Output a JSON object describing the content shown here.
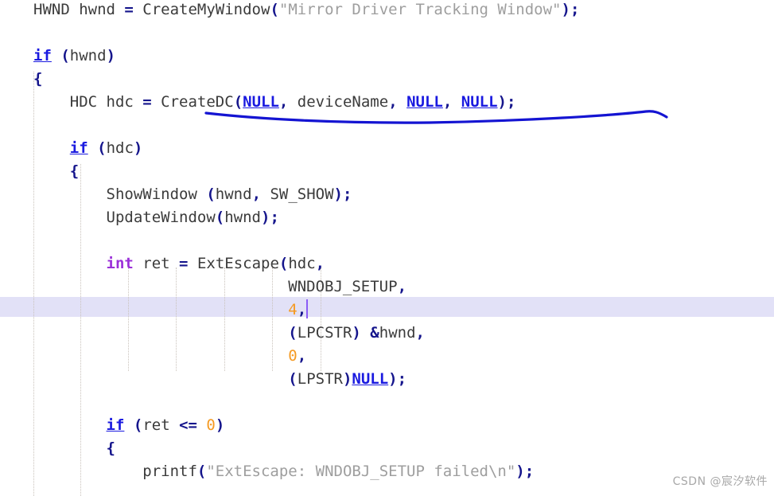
{
  "editor": {
    "language": "C",
    "background_color": "#ffffff",
    "current_line_highlight_color": "#e2e1f7",
    "caret_color": "#8b5cf6",
    "indent_guide_color": "#c9c2bb",
    "colors": {
      "plain_text": "#3b3b3b",
      "keyword": "#1a1ae0",
      "type": "#9b30d9",
      "string": "#9e9e9e",
      "number": "#f59a23",
      "operator": "#15158c",
      "annotation_ink": "#1414d2"
    }
  },
  "lines": [
    {
      "n": 1,
      "text": "HWND hwnd = CreateMyWindow(\"Mirror Driver Tracking Window\");"
    },
    {
      "n": 2,
      "text": ""
    },
    {
      "n": 3,
      "text": "if (hwnd)"
    },
    {
      "n": 4,
      "text": "{"
    },
    {
      "n": 5,
      "text": "    HDC hdc = CreateDC(NULL, deviceName, NULL, NULL);"
    },
    {
      "n": 6,
      "text": ""
    },
    {
      "n": 7,
      "text": "    if (hdc)"
    },
    {
      "n": 8,
      "text": "    {"
    },
    {
      "n": 9,
      "text": "        ShowWindow (hwnd, SW_SHOW);"
    },
    {
      "n": 10,
      "text": "        UpdateWindow(hwnd);"
    },
    {
      "n": 11,
      "text": ""
    },
    {
      "n": 12,
      "text": "        int ret = ExtEscape(hdc,"
    },
    {
      "n": 13,
      "text": "                            WNDOBJ_SETUP,"
    },
    {
      "n": 14,
      "text": "                            4,"
    },
    {
      "n": 15,
      "text": "                            (LPCSTR) &hwnd,"
    },
    {
      "n": 16,
      "text": "                            0,"
    },
    {
      "n": 17,
      "text": "                            (LPSTR)NULL);"
    },
    {
      "n": 18,
      "text": ""
    },
    {
      "n": 19,
      "text": "        if (ret <= 0)"
    },
    {
      "n": 20,
      "text": "        {"
    },
    {
      "n": 21,
      "text": "            printf(\"ExtEscape: WNDOBJ_SETUP failed\\n\");"
    }
  ],
  "tokens": {
    "l1": [
      {
        "t": "HWND hwnd ",
        "c": "plain"
      },
      {
        "t": "=",
        "c": "op"
      },
      {
        "t": " CreateMyWindow",
        "c": "plain"
      },
      {
        "t": "(",
        "c": "punct"
      },
      {
        "t": "\"Mirror Driver Tracking Window\"",
        "c": "str"
      },
      {
        "t": ")",
        "c": "punct"
      },
      {
        "t": ";",
        "c": "punct"
      }
    ],
    "l3": [
      {
        "t": "if",
        "c": "kw"
      },
      {
        "t": " ",
        "c": "plain"
      },
      {
        "t": "(",
        "c": "punct"
      },
      {
        "t": "hwnd",
        "c": "plain"
      },
      {
        "t": ")",
        "c": "punct"
      }
    ],
    "l4": [
      {
        "t": "{",
        "c": "brace"
      }
    ],
    "l5": [
      {
        "t": "    HDC hdc ",
        "c": "plain"
      },
      {
        "t": "=",
        "c": "op"
      },
      {
        "t": " CreateDC",
        "c": "plain"
      },
      {
        "t": "(",
        "c": "punct"
      },
      {
        "t": "NULL",
        "c": "macro"
      },
      {
        "t": ",",
        "c": "punct"
      },
      {
        "t": " deviceName",
        "c": "plain"
      },
      {
        "t": ",",
        "c": "punct"
      },
      {
        "t": " ",
        "c": "plain"
      },
      {
        "t": "NULL",
        "c": "macro"
      },
      {
        "t": ",",
        "c": "punct"
      },
      {
        "t": " ",
        "c": "plain"
      },
      {
        "t": "NULL",
        "c": "macro"
      },
      {
        "t": ")",
        "c": "punct"
      },
      {
        "t": ";",
        "c": "punct"
      }
    ],
    "l7": [
      {
        "t": "    ",
        "c": "plain"
      },
      {
        "t": "if",
        "c": "kw"
      },
      {
        "t": " ",
        "c": "plain"
      },
      {
        "t": "(",
        "c": "punct"
      },
      {
        "t": "hdc",
        "c": "plain"
      },
      {
        "t": ")",
        "c": "punct"
      }
    ],
    "l8": [
      {
        "t": "    ",
        "c": "plain"
      },
      {
        "t": "{",
        "c": "brace"
      }
    ],
    "l9": [
      {
        "t": "        ShowWindow ",
        "c": "plain"
      },
      {
        "t": "(",
        "c": "punct"
      },
      {
        "t": "hwnd",
        "c": "plain"
      },
      {
        "t": ",",
        "c": "punct"
      },
      {
        "t": " SW_SHOW",
        "c": "plain"
      },
      {
        "t": ")",
        "c": "punct"
      },
      {
        "t": ";",
        "c": "punct"
      }
    ],
    "l10": [
      {
        "t": "        UpdateWindow",
        "c": "plain"
      },
      {
        "t": "(",
        "c": "punct"
      },
      {
        "t": "hwnd",
        "c": "plain"
      },
      {
        "t": ")",
        "c": "punct"
      },
      {
        "t": ";",
        "c": "punct"
      }
    ],
    "l12": [
      {
        "t": "        ",
        "c": "plain"
      },
      {
        "t": "int",
        "c": "type"
      },
      {
        "t": " ret ",
        "c": "plain"
      },
      {
        "t": "=",
        "c": "op"
      },
      {
        "t": " ExtEscape",
        "c": "plain"
      },
      {
        "t": "(",
        "c": "punct"
      },
      {
        "t": "hdc",
        "c": "plain"
      },
      {
        "t": ",",
        "c": "punct"
      }
    ],
    "l13": [
      {
        "t": "                            WNDOBJ_SETUP",
        "c": "plain"
      },
      {
        "t": ",",
        "c": "punct"
      }
    ],
    "l14": [
      {
        "t": "                            ",
        "c": "plain"
      },
      {
        "t": "4",
        "c": "num"
      },
      {
        "t": ",",
        "c": "punct"
      }
    ],
    "l15": [
      {
        "t": "                            ",
        "c": "plain"
      },
      {
        "t": "(",
        "c": "punct"
      },
      {
        "t": "LPCSTR",
        "c": "plain"
      },
      {
        "t": ")",
        "c": "punct"
      },
      {
        "t": " ",
        "c": "plain"
      },
      {
        "t": "&",
        "c": "op"
      },
      {
        "t": "hwnd",
        "c": "plain"
      },
      {
        "t": ",",
        "c": "punct"
      }
    ],
    "l16": [
      {
        "t": "                            ",
        "c": "plain"
      },
      {
        "t": "0",
        "c": "num"
      },
      {
        "t": ",",
        "c": "punct"
      }
    ],
    "l17": [
      {
        "t": "                            ",
        "c": "plain"
      },
      {
        "t": "(",
        "c": "punct"
      },
      {
        "t": "LPSTR",
        "c": "plain"
      },
      {
        "t": ")",
        "c": "punct"
      },
      {
        "t": "NULL",
        "c": "macro"
      },
      {
        "t": ")",
        "c": "punct"
      },
      {
        "t": ";",
        "c": "punct"
      }
    ],
    "l19": [
      {
        "t": "        ",
        "c": "plain"
      },
      {
        "t": "if",
        "c": "kw"
      },
      {
        "t": " ",
        "c": "plain"
      },
      {
        "t": "(",
        "c": "punct"
      },
      {
        "t": "ret ",
        "c": "plain"
      },
      {
        "t": "<=",
        "c": "op"
      },
      {
        "t": " ",
        "c": "plain"
      },
      {
        "t": "0",
        "c": "num"
      },
      {
        "t": ")",
        "c": "punct"
      }
    ],
    "l20": [
      {
        "t": "        ",
        "c": "plain"
      },
      {
        "t": "{",
        "c": "brace"
      }
    ],
    "l21": [
      {
        "t": "            printf",
        "c": "plain"
      },
      {
        "t": "(",
        "c": "punct"
      },
      {
        "t": "\"ExtEscape: WNDOBJ_SETUP failed\\n\"",
        "c": "str"
      },
      {
        "t": ")",
        "c": "punct"
      },
      {
        "t": ";",
        "c": "punct"
      }
    ]
  },
  "current_line": {
    "line_number": 14,
    "caret_after": "4,"
  },
  "annotation": {
    "type": "hand-drawn-underline",
    "target_line": 5,
    "target_text": "CreateDC(NULL, deviceName, NULL, NULL);",
    "ink_color": "#1414d2"
  },
  "watermark": {
    "text": "CSDN @宸汐软件"
  }
}
